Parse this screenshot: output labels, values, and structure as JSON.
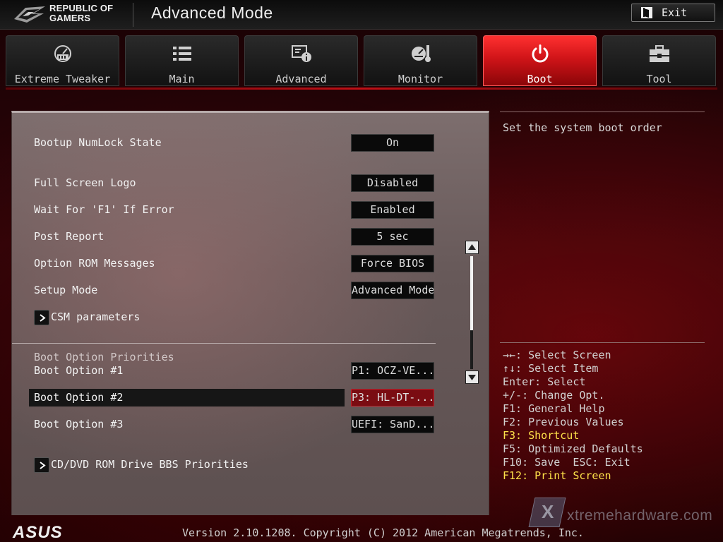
{
  "header": {
    "brand_line1": "REPUBLIC OF",
    "brand_line2": "GAMERS",
    "mode_title": "Advanced Mode",
    "exit_label": "Exit",
    "logo_icon": "rog-eye-icon",
    "exit_icon": "exit-door-icon"
  },
  "tabs": [
    {
      "label": "Extreme Tweaker",
      "icon": "extreme-tweaker-icon",
      "active": false
    },
    {
      "label": "Main",
      "icon": "list-icon",
      "active": false
    },
    {
      "label": "Advanced",
      "icon": "advanced-settings-icon",
      "active": false
    },
    {
      "label": "Monitor",
      "icon": "monitor-gauge-icon",
      "active": false
    },
    {
      "label": "Boot",
      "icon": "power-icon",
      "active": true
    },
    {
      "label": "Tool",
      "icon": "toolbox-icon",
      "active": false
    }
  ],
  "settings": {
    "numlock": {
      "label": "Bootup NumLock State",
      "value": "On"
    },
    "fullscreen_logo": {
      "label": "Full Screen Logo",
      "value": "Disabled"
    },
    "wait_f1": {
      "label": "Wait For 'F1' If Error",
      "value": "Enabled"
    },
    "post_report": {
      "label": "Post Report",
      "value": "5 sec"
    },
    "option_rom": {
      "label": "Option ROM Messages",
      "value": "Force BIOS"
    },
    "setup_mode": {
      "label": "Setup Mode",
      "value": "Advanced Mode"
    },
    "csm": {
      "label": "CSM parameters"
    }
  },
  "boot_priorities": {
    "section_title": "Boot Option Priorities",
    "options": [
      {
        "label": "Boot Option #1",
        "value": "P1: OCZ-VE..."
      },
      {
        "label": "Boot Option #2",
        "value": "P3: HL-DT-..."
      },
      {
        "label": "Boot Option #3",
        "value": "UEFI: SanD..."
      }
    ],
    "cddvd_submenu": "CD/DVD ROM Drive BBS Priorities"
  },
  "help": {
    "description": "Set the system boot order",
    "shortcuts": [
      {
        "text": "→←: Select Screen",
        "highlight": false
      },
      {
        "text": "↑↓: Select Item",
        "highlight": false
      },
      {
        "text": "Enter: Select",
        "highlight": false
      },
      {
        "text": "+/-: Change Opt.",
        "highlight": false
      },
      {
        "text": "F1: General Help",
        "highlight": false
      },
      {
        "text": "F2: Previous Values",
        "highlight": false
      },
      {
        "text": "F3: Shortcut",
        "highlight": true
      },
      {
        "text": "F5: Optimized Defaults",
        "highlight": false
      },
      {
        "text": "F10: Save  ESC: Exit",
        "highlight": false
      },
      {
        "text": "F12: Print Screen",
        "highlight": true
      }
    ]
  },
  "footer": {
    "brand": "ASUS",
    "version": "Version 2.10.1208. Copyright (C) 2012 American Megatrends, Inc.",
    "watermark": "xtremehardware.com",
    "watermark_badge": "X"
  },
  "colors": {
    "active_tab": "#d01418",
    "highlight_text": "#ffe24a",
    "panel_bg": "#6e6060",
    "value_bg": "#0a0a0a",
    "focus_value_bg": "#7a0c12"
  }
}
